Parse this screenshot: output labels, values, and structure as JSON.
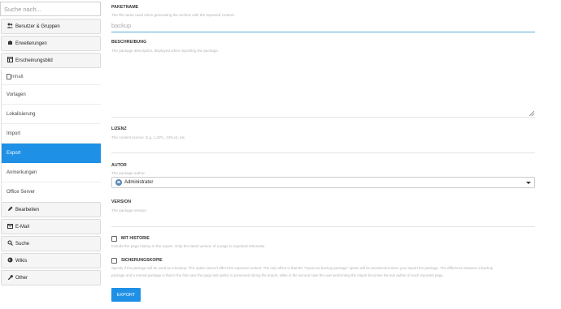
{
  "search": {
    "placeholder": "Suche nach..."
  },
  "sidebar": {
    "sections_top": [
      {
        "label": "Benutzer & Gruppen",
        "icon": "users-icon"
      },
      {
        "label": "Erweiterungen",
        "icon": "puzzle-icon"
      },
      {
        "label": "Erscheinungsbild",
        "icon": "layout-icon"
      }
    ],
    "content_header": {
      "label": "Inhalt",
      "icon": "document-icon"
    },
    "content_items": [
      "Vorlagen",
      "Lokalisierung",
      "Import",
      "Export",
      "Anmerkungen",
      "Office Server"
    ],
    "active_item": "Export",
    "sections_bottom": [
      {
        "label": "Bearbeiten",
        "icon": "pencil-icon"
      },
      {
        "label": "E-Mail",
        "icon": "envelope-icon"
      },
      {
        "label": "Suche",
        "icon": "search-icon"
      },
      {
        "label": "Wikis",
        "icon": "globe-icon"
      },
      {
        "label": "Other",
        "icon": "wrench-icon"
      }
    ]
  },
  "form": {
    "package_name": {
      "label": "PAKETNAME",
      "hint": "The file name used when generating the archive with the exported content.",
      "placeholder": "backup"
    },
    "description": {
      "label": "BESCHREIBUNG",
      "hint": "The package description, displayed when importing the package."
    },
    "license": {
      "label": "LIZENZ",
      "hint": "The content licence. E.g.: LGPL, GPLv3, etc."
    },
    "author": {
      "label": "AUTOR",
      "hint": "The package author.",
      "value": "Administrator"
    },
    "version": {
      "label": "VERSION",
      "hint": "The package version."
    },
    "with_history": {
      "label": "MIT HISTORIE",
      "hint": "Include the page history in the export. Only the latest version of a page is exported otherwise."
    },
    "backup": {
      "label": "SICHERUNGSKOPIE",
      "hint1": "Specify if the package will be used as a backup. This option doesn't affect the exported content. The only effect is that the \"Import as backup package\" option will be preselected when your import the package. The difference between a backup",
      "hint2": "package and a normal package is that in the first case the page last author is preserved during the import, while in the second case the user performing the import becomes the last author of each imported page."
    },
    "export_button": "EXPORT"
  },
  "colors": {
    "accent": "#1e90e6",
    "input_focus": "#5aaed6"
  }
}
